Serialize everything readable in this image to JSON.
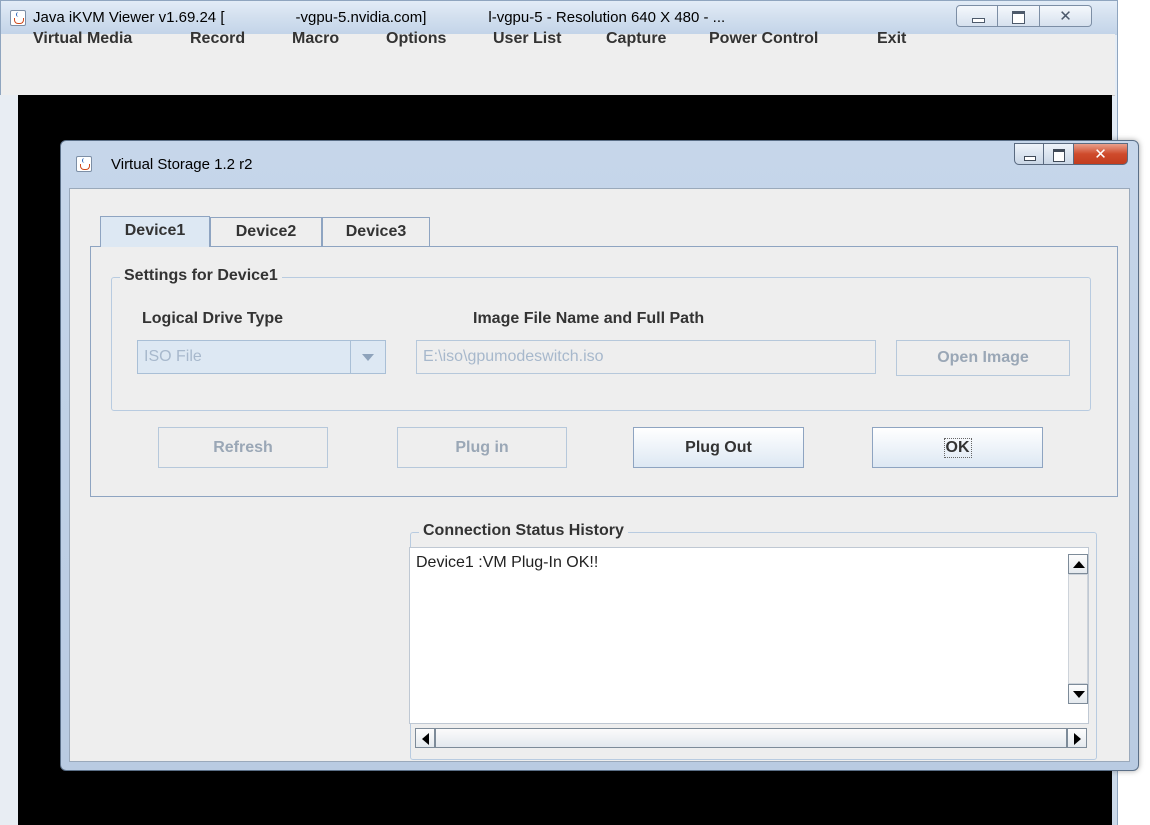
{
  "outer_window": {
    "title_part1": "Java iKVM Viewer v1.69.24 [",
    "title_part2": "-vgpu-5.nvidia.com]",
    "title_part3": "l-vgpu-5 - Resolution 640 X 480 - ..."
  },
  "menubar": {
    "items": [
      "Virtual Media",
      "Record",
      "Macro",
      "Options",
      "User List",
      "Capture",
      "Power Control",
      "Exit"
    ]
  },
  "dialog": {
    "title": "Virtual Storage 1.2 r2",
    "tabs": [
      "Device1",
      "Device2",
      "Device3"
    ],
    "active_tab": "Device1",
    "settings_legend": "Settings for Device1",
    "drive_type_label": "Logical Drive Type",
    "drive_type_value": "ISO File",
    "image_path_label": "Image File Name and Full Path",
    "image_path_value": "E:\\iso\\gpumodeswitch.iso",
    "open_image_label": "Open Image",
    "buttons": {
      "refresh": "Refresh",
      "plug_in": "Plug in",
      "plug_out": "Plug Out",
      "ok": "OK"
    },
    "status_legend": "Connection Status History",
    "status_lines": [
      "Device1 :VM Plug-In OK!!"
    ]
  },
  "colors": {
    "accent_border": "#8ea4c1",
    "dialog_frame": "#c6d6ea",
    "disabled_text": "#a7b8cc"
  }
}
